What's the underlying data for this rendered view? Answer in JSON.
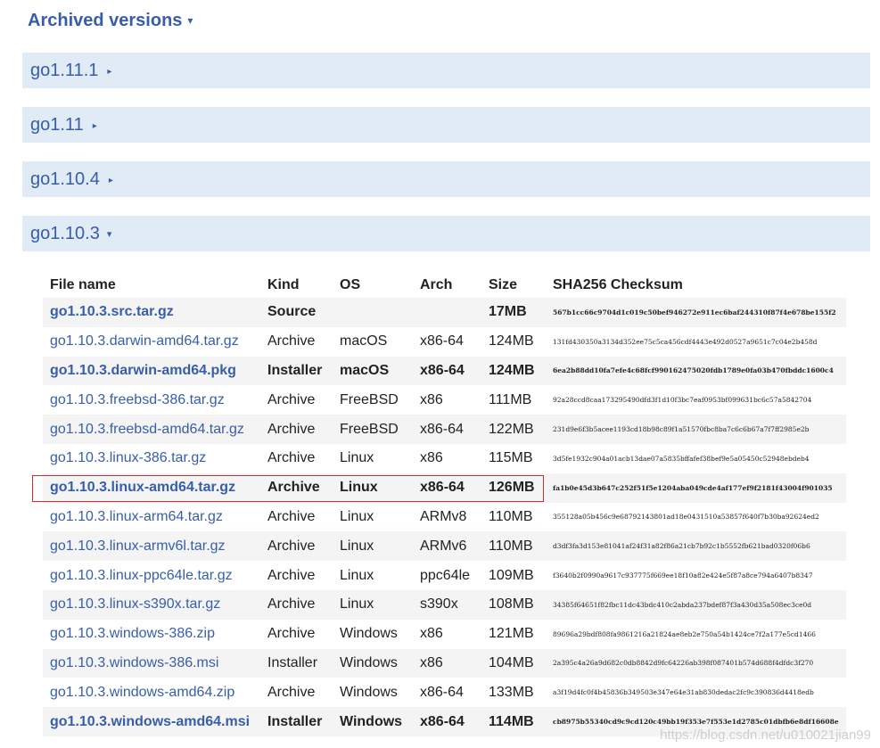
{
  "section": {
    "title": "Archived versions",
    "caret": "▾"
  },
  "versions": [
    {
      "label": "go1.11.1",
      "toggle": "▸"
    },
    {
      "label": "go1.11",
      "toggle": "▸"
    },
    {
      "label": "go1.10.4",
      "toggle": "▸"
    },
    {
      "label": "go1.10.3",
      "toggle": "▾"
    }
  ],
  "table": {
    "headers": {
      "file": "File name",
      "kind": "Kind",
      "os": "OS",
      "arch": "Arch",
      "size": "Size",
      "sha": "SHA256 Checksum"
    },
    "rows": [
      {
        "file": "go1.10.3.src.tar.gz",
        "kind": "Source",
        "os": "",
        "arch": "",
        "size": "17MB",
        "sha": "567b1cc66c9704d1c019c50bef946272e911ec6baf244310f87f4e678be155f2",
        "bold": true
      },
      {
        "file": "go1.10.3.darwin-amd64.tar.gz",
        "kind": "Archive",
        "os": "macOS",
        "arch": "x86-64",
        "size": "124MB",
        "sha": "131fd430350a3134d352ee75c5ca456cdf4443e492d0527a9651c7c04e2b458d",
        "bold": false
      },
      {
        "file": "go1.10.3.darwin-amd64.pkg",
        "kind": "Installer",
        "os": "macOS",
        "arch": "x86-64",
        "size": "124MB",
        "sha": "6ea2b88dd10fa7efe4c68fcf990162475020fdb1789e0fa03b470fbddc1600c4",
        "bold": true
      },
      {
        "file": "go1.10.3.freebsd-386.tar.gz",
        "kind": "Archive",
        "os": "FreeBSD",
        "arch": "x86",
        "size": "111MB",
        "sha": "92a28ccd8caa173295490dfd3f1d10f3bc7eaf0953bf099631bc6c57a5842704",
        "bold": false
      },
      {
        "file": "go1.10.3.freebsd-amd64.tar.gz",
        "kind": "Archive",
        "os": "FreeBSD",
        "arch": "x86-64",
        "size": "122MB",
        "sha": "231d9e6f3b5acee1193cd18b98c89f1a51570fbc8ba7c6c6b67a7f7ff2985e2b",
        "bold": false
      },
      {
        "file": "go1.10.3.linux-386.tar.gz",
        "kind": "Archive",
        "os": "Linux",
        "arch": "x86",
        "size": "115MB",
        "sha": "3d5fe1932c904a01acb13dae07a5835bffafef38bef9e5a05450c52948ebdeb4",
        "bold": false
      },
      {
        "file": "go1.10.3.linux-amd64.tar.gz",
        "kind": "Archive",
        "os": "Linux",
        "arch": "x86-64",
        "size": "126MB",
        "sha": "fa1b0e45d3b647c252f51f5e1204aba049cde4af177ef9f2181f43004f901035",
        "bold": true
      },
      {
        "file": "go1.10.3.linux-arm64.tar.gz",
        "kind": "Archive",
        "os": "Linux",
        "arch": "ARMv8",
        "size": "110MB",
        "sha": "355128a05b456c9e68792143801ad18e0431510a53857f640f7b30ba92624ed2",
        "bold": false
      },
      {
        "file": "go1.10.3.linux-armv6l.tar.gz",
        "kind": "Archive",
        "os": "Linux",
        "arch": "ARMv6",
        "size": "110MB",
        "sha": "d3df3fa3d153e81041af24f31a82f86a21cb7b92c1b5552fb621bad0320f06b6",
        "bold": false
      },
      {
        "file": "go1.10.3.linux-ppc64le.tar.gz",
        "kind": "Archive",
        "os": "Linux",
        "arch": "ppc64le",
        "size": "109MB",
        "sha": "f3640b2f0990a9617c937775f669ee18f10a82e424e5f87a8ce794a6407b8347",
        "bold": false
      },
      {
        "file": "go1.10.3.linux-s390x.tar.gz",
        "kind": "Archive",
        "os": "Linux",
        "arch": "s390x",
        "size": "108MB",
        "sha": "34385f64651f82fbc11dc43bdc410c2abda237bdef87f3a430d35a508ec3ce0d",
        "bold": false
      },
      {
        "file": "go1.10.3.windows-386.zip",
        "kind": "Archive",
        "os": "Windows",
        "arch": "x86",
        "size": "121MB",
        "sha": "89696a29bdf808fa9861216a21824ae8eb2e750a54b1424ce7f2a177e5cd1466",
        "bold": false
      },
      {
        "file": "go1.10.3.windows-386.msi",
        "kind": "Installer",
        "os": "Windows",
        "arch": "x86",
        "size": "104MB",
        "sha": "2a395c4a26a9d682c0db8842d9fc64226ab398f087401b574d688f4dfdc3f270",
        "bold": false
      },
      {
        "file": "go1.10.3.windows-amd64.zip",
        "kind": "Archive",
        "os": "Windows",
        "arch": "x86-64",
        "size": "133MB",
        "sha": "a3f19d4fc0f4b45836b349503e347e64e31ab830dedac2fc9c390836d4418edb",
        "bold": false
      },
      {
        "file": "go1.10.3.windows-amd64.msi",
        "kind": "Installer",
        "os": "Windows",
        "arch": "x86-64",
        "size": "114MB",
        "sha": "cb8975b55340cd9c9cd120c49bb19f353e7f553e1d2785c01dbfb6e8df16608e",
        "bold": true
      }
    ]
  },
  "watermark": "https://blog.csdn.net/u010021jian99"
}
